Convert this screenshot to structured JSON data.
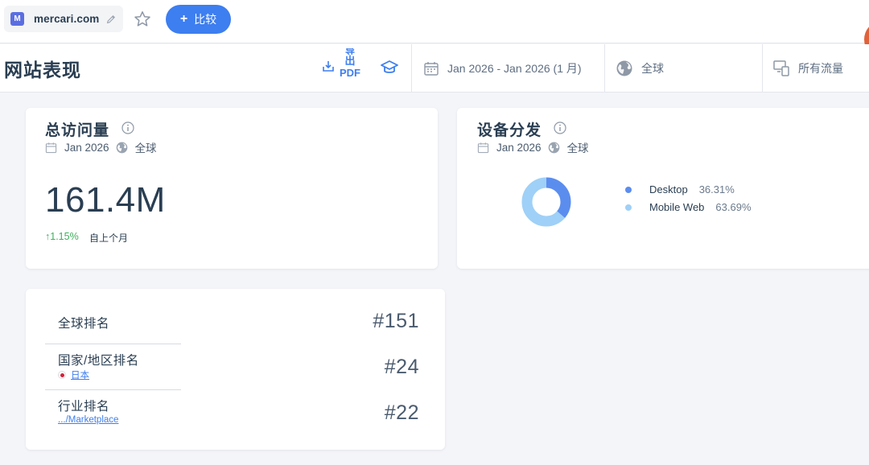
{
  "topbar": {
    "site": "mercari.com",
    "favicon_letter": "M",
    "compare_label": "比较",
    "compare_plus": "+"
  },
  "header": {
    "title": "网站表现",
    "export_line1": "导",
    "export_line2": "出",
    "export_line3": "PDF",
    "date_range": "Jan 2026 - Jan 2026 (1 月)",
    "region": "全球",
    "traffic": "所有流量"
  },
  "visits_card": {
    "title": "总访问量",
    "date": "Jan 2026",
    "region": "全球",
    "value": "161.4M",
    "change": "↑1.15%",
    "change_label": "自上个月"
  },
  "device_card": {
    "title": "设备分发",
    "date": "Jan 2026",
    "region": "全球",
    "items": [
      {
        "label": "Desktop",
        "pct": "36.31%",
        "share": 36.31,
        "color": "#5b8def"
      },
      {
        "label": "Mobile Web",
        "pct": "63.69%",
        "share": 63.69,
        "color": "#9fd0f7"
      }
    ]
  },
  "rank_card": {
    "global_label": "全球排名",
    "global_value": "#151",
    "country_label": "国家/地区排名",
    "country_sub": "日本",
    "country_value": "#24",
    "industry_label": "行业排名",
    "industry_sub": ".../Marketplace",
    "industry_value": "#22"
  },
  "colors": {
    "accent": "#3d7ef0",
    "positive": "#3cb05a",
    "desktop": "#5b8def",
    "mobile": "#9fd0f7"
  }
}
